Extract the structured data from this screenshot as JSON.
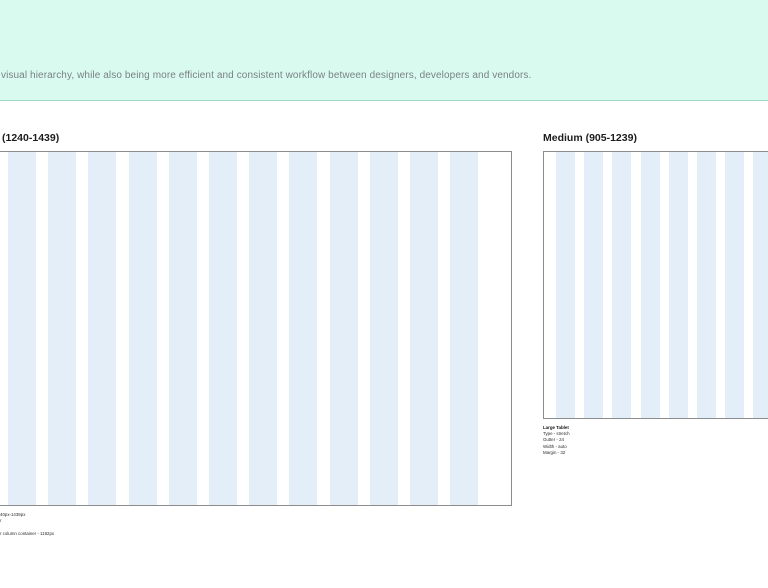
{
  "header": {
    "intro": "visual hierarchy, while also being more efficient and consistent workflow between designers, developers and vendors."
  },
  "large_frame": {
    "title": "(1240-1439)",
    "column_count": 12,
    "spec_lines": [
      "40px-1439px",
      "r",
      "",
      "r column container - 1192px"
    ]
  },
  "medium_frame": {
    "title": "Medium (905-1239)",
    "column_count": 8,
    "spec_title": "Large Tablet",
    "spec_lines": [
      "Type - stretch",
      "Gutter - 24",
      "Width - auto",
      "Margin - 32"
    ]
  },
  "colors": {
    "header_bg": "#d9fbef",
    "column_fill": "#e3eef9",
    "frame_border": "#8c8c8c"
  }
}
